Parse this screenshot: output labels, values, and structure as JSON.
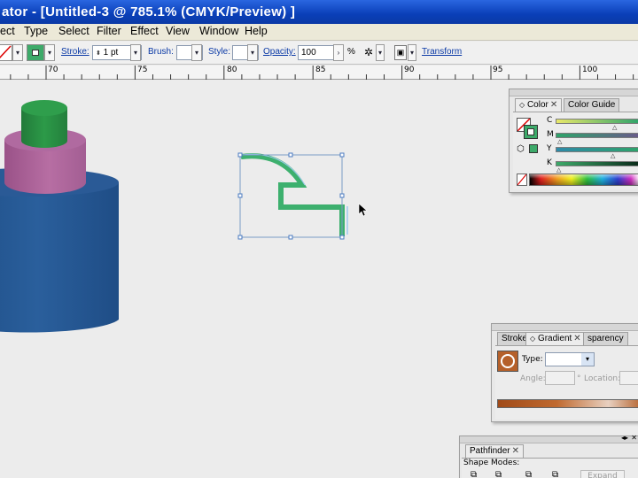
{
  "window": {
    "title": "ator - [Untitled-3 @ 785.1% (CMYK/Preview) ]"
  },
  "menu": {
    "items": [
      "ect",
      "Type",
      "Select",
      "Filter",
      "Effect",
      "View",
      "Window",
      "Help"
    ]
  },
  "control_bar": {
    "stroke_label": "Stroke:",
    "stroke_value": "1 pt",
    "brush_label": "Brush:",
    "style_label": "Style:",
    "opacity_label": "Opacity:",
    "opacity_value": "100",
    "opacity_unit": "%",
    "transform_label": "Transform"
  },
  "ruler": {
    "labels": [
      "70",
      "75",
      "80",
      "85",
      "90",
      "95",
      "100"
    ]
  },
  "color_panel": {
    "tabs": [
      "Color",
      "Color Guide"
    ],
    "channels": [
      "C",
      "M",
      "Y",
      "K"
    ],
    "colors": {
      "fill": "#ffffff",
      "stroke": "#3daa6a",
      "c": "#2ea36a",
      "m": "#3a8a6a",
      "y": "#2ea36a",
      "k": "#2a5a46"
    }
  },
  "gradient_panel": {
    "tabs": [
      "Stroke",
      "Gradient",
      "sparency"
    ],
    "type_label": "Type:",
    "angle_label": "Angle:",
    "angle_unit": "°",
    "location_label": "Location:"
  },
  "pathfinder_panel": {
    "tabs": [
      "Pathfinder"
    ],
    "shape_modes_label": "Shape Modes:",
    "expand_label": "Expand"
  },
  "canvas": {
    "colors": {
      "cylinder_blue": "#2a5f9c",
      "cylinder_pink": "#b76ea3",
      "cylinder_green": "#2c9a48",
      "path_green": "#3db06e"
    }
  }
}
